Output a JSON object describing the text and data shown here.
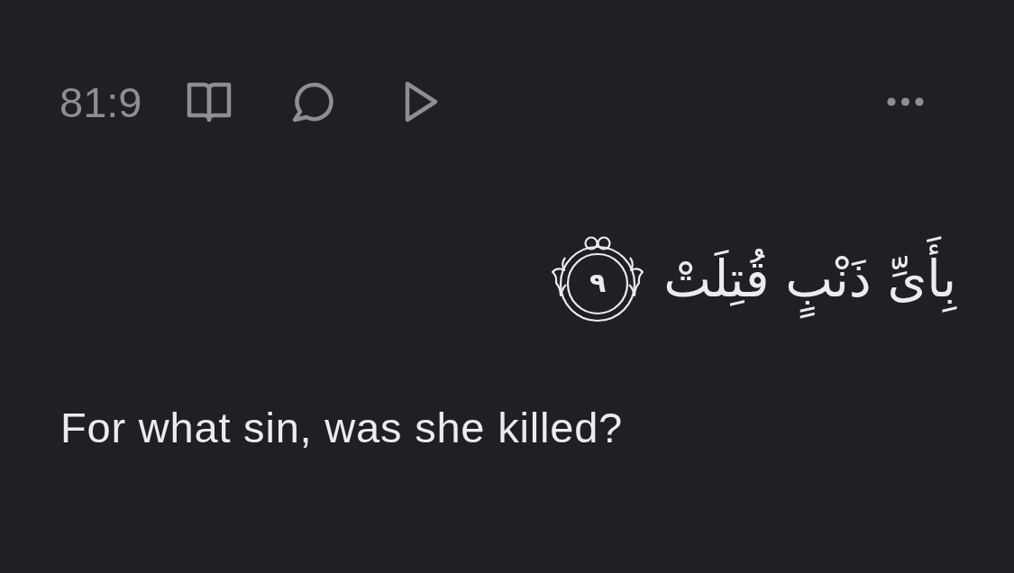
{
  "verse_header": {
    "reference": "81:9"
  },
  "arabic": {
    "text": "بِأَىِّ ذَنْبٍ قُتِلَتْ",
    "verse_number": "٩"
  },
  "translation": {
    "text": "For what sin, was she killed?"
  }
}
